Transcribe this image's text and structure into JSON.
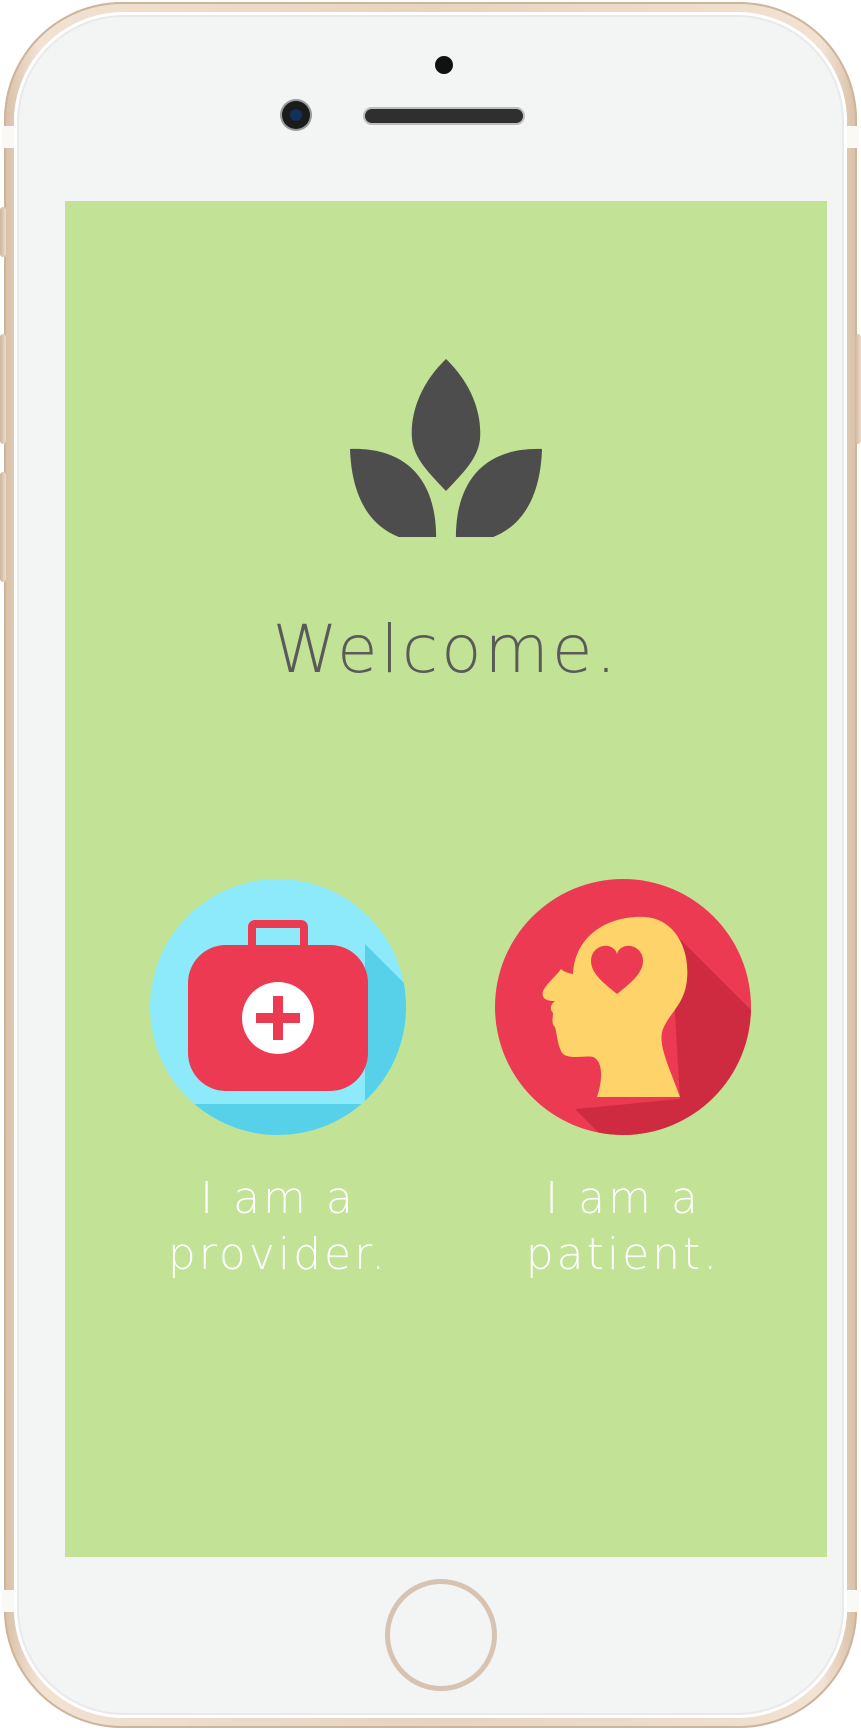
{
  "screen": {
    "background_color": "#c2e296",
    "logo_icon": "leaf-sprout-icon",
    "welcome_text": "Welcome."
  },
  "choices": [
    {
      "id": "provider",
      "icon": "first-aid-kit-icon",
      "line1": "I am a",
      "line2": "provider.",
      "circle_color": "#8ceafb",
      "accent_color": "#ec3a53"
    },
    {
      "id": "patient",
      "icon": "head-heart-icon",
      "line1": "I am a",
      "line2": "patient.",
      "circle_color": "#ec3a53",
      "accent_color": "#fed46a"
    }
  ]
}
